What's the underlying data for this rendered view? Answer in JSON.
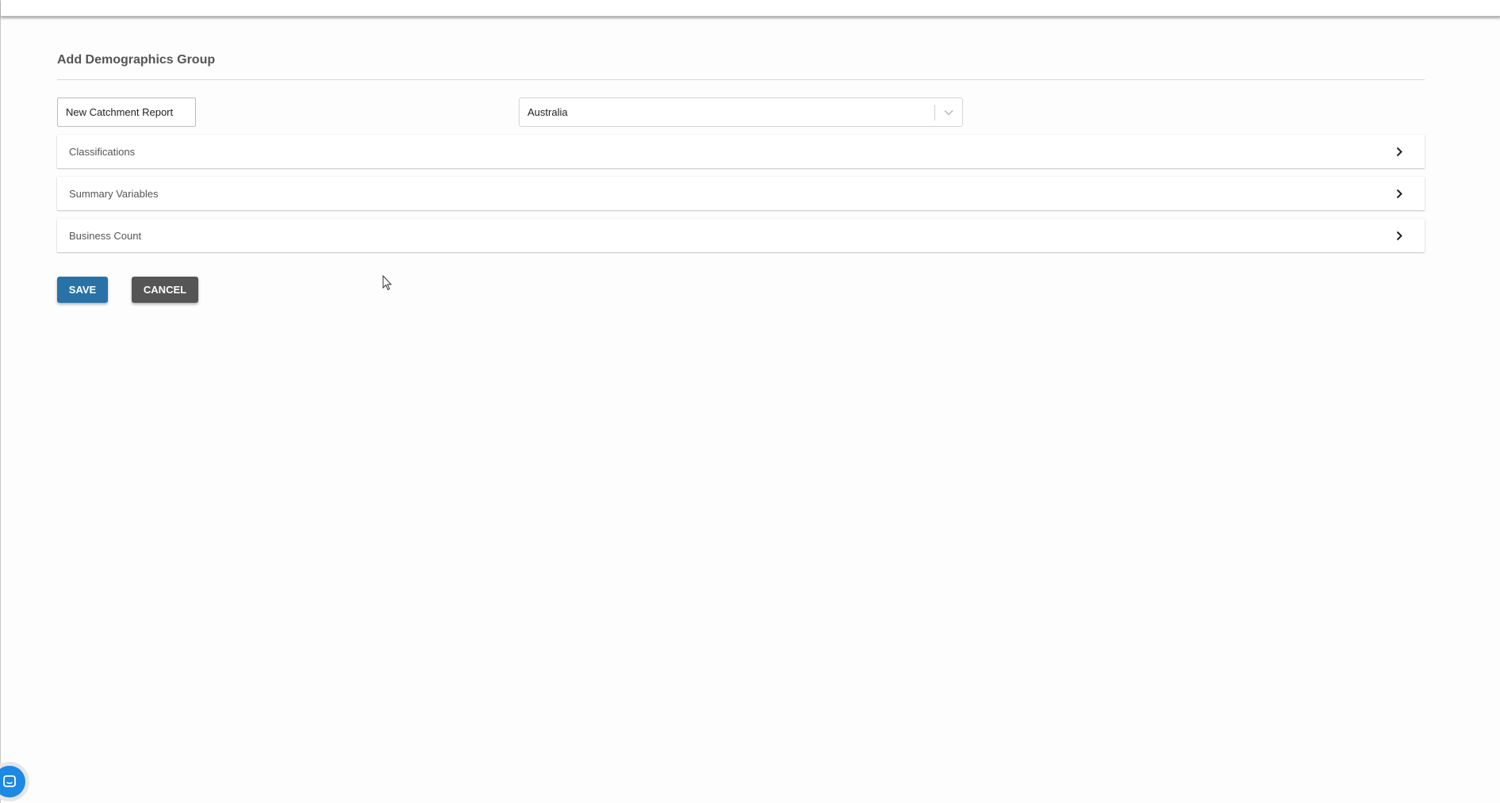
{
  "form": {
    "title": "Add Demographics Group",
    "name_input": {
      "value": "New Catchment Report",
      "placeholder": ""
    },
    "country_select": {
      "selected": "Australia"
    }
  },
  "accordion": {
    "items": [
      {
        "label": "Classifications",
        "icon": "chevron-right-icon"
      },
      {
        "label": "Summary Variables",
        "icon": "chevron-right-icon"
      },
      {
        "label": "Business Count",
        "icon": "chevron-right-icon"
      }
    ]
  },
  "actions": {
    "save_label": "SAVE",
    "cancel_label": "CANCEL"
  },
  "colors": {
    "primary": "#2872a8",
    "secondary": "#555555",
    "chat_launcher": "#1e88e5"
  },
  "icons": {
    "select_indicator": "chevron-down-icon",
    "chat": "chat-bubble-icon",
    "cursor": "mouse-pointer-icon"
  }
}
